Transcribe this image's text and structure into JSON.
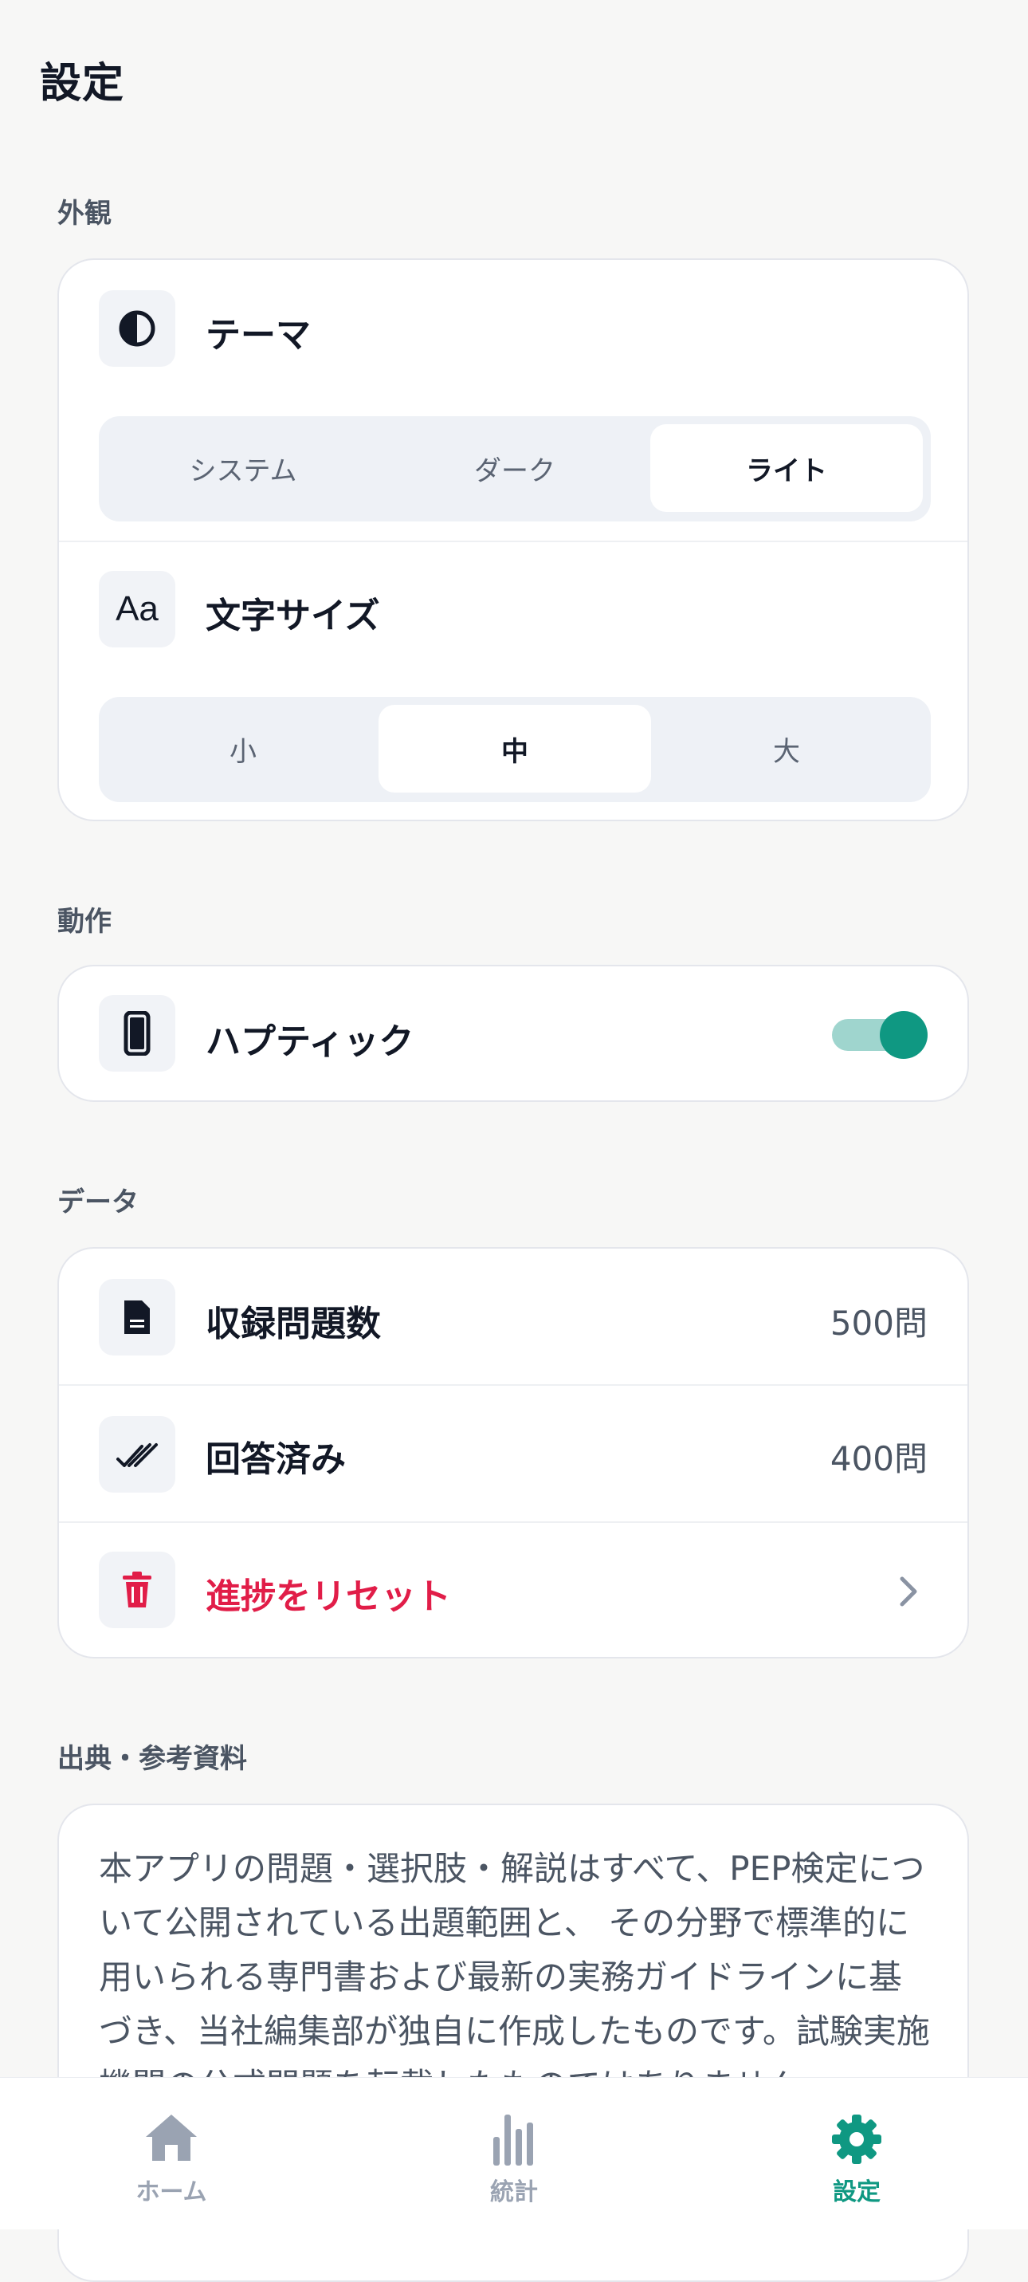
{
  "page": {
    "title": "設定"
  },
  "appearance": {
    "section_label": "外観",
    "theme": {
      "label": "テーマ",
      "icon": "contrast-icon",
      "options": [
        "システム",
        "ダーク",
        "ライト"
      ],
      "selected": "ライト"
    },
    "text_size": {
      "label": "文字サイズ",
      "icon": "text-size-icon",
      "icon_text": "Aa",
      "options": [
        "小",
        "中",
        "大"
      ],
      "selected": "中"
    }
  },
  "behavior": {
    "section_label": "動作",
    "haptic": {
      "label": "ハプティック",
      "icon": "phone-icon",
      "enabled": true
    }
  },
  "data_section": {
    "section_label": "データ",
    "question_count": {
      "label": "収録問題数",
      "value": "500問",
      "icon": "document-icon"
    },
    "answered": {
      "label": "回答済み",
      "value": "400問",
      "icon": "double-check-icon"
    },
    "reset": {
      "label": "進捗をリセット",
      "icon": "trash-icon"
    }
  },
  "sources": {
    "section_label": "出典・参考資料",
    "body": "本アプリの問題・選択肢・解説はすべて、PEP検定について公開されている出題範囲と、 その分野で標準的に用いられる専門書および最新の実務ガイドラインに基づき、当社編集部が独自に作成したものです。試験実施機関の公式問題を転載したものではありません。"
  },
  "tab_bar": {
    "tabs": [
      {
        "label": "ホーム",
        "icon": "home-icon"
      },
      {
        "label": "統計",
        "icon": "bar-chart-icon"
      },
      {
        "label": "設定",
        "icon": "gear-icon"
      }
    ],
    "active": "設定"
  },
  "colors": {
    "accent": "#0f9882",
    "danger": "#e11d48",
    "background": "#f7f7f6",
    "card": "#ffffff"
  }
}
